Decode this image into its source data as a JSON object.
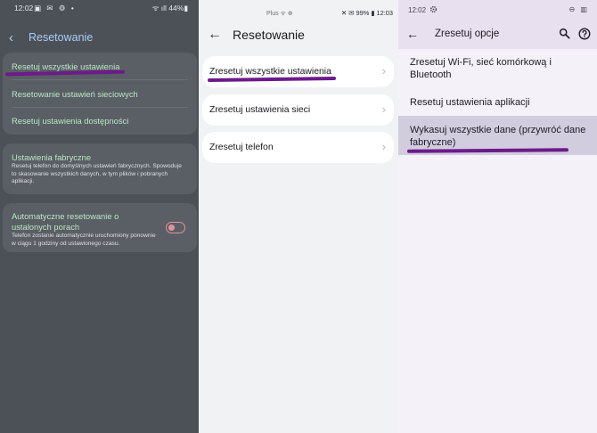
{
  "colors": {
    "samsung_bg": "#4c5057",
    "samsung_card": "#5a5e65",
    "samsung_title": "#a9cdf3",
    "samsung_item": "#b9e7c3",
    "vivo_bg": "#f1f2f4",
    "pixel_bg": "#f5f1f9",
    "pixel_header": "#e8e0ee",
    "pixel_highlight": "#d1ccde",
    "underline": "#6d1a8a"
  },
  "samsung": {
    "status": {
      "time": "12:02",
      "icons": "▣ ✉ ⚙ •",
      "right": "ᯤ ıll 44%▮"
    },
    "header": {
      "title": "Resetowanie"
    },
    "items": [
      {
        "label": "Resetuj wszystkie ustawienia"
      },
      {
        "label": "Resetowanie ustawień sieciowych"
      },
      {
        "label": "Resetuj ustawienia dostępności"
      }
    ],
    "factory": {
      "title": "Ustawienia fabryczne",
      "description": "Resetuj telefon do domyślnych ustawień fabrycznych. Spowoduje to skasowanie wszystkich danych, w tym plików i pobranych aplikacji."
    },
    "auto_reset": {
      "title": "Automatyczne resetowanie o ustalonych porach",
      "description": "Telefon zostanie automatycznie uruchomiony ponownie w ciągu 1 godziny od ustawionego czasu.",
      "enabled": false
    }
  },
  "vivo": {
    "status": {
      "center": "Plus  ᯤ ⊕",
      "right": "✕ ✉ 99% ▮ 12:03"
    },
    "header": {
      "title": "Resetowanie"
    },
    "items": [
      {
        "label": "Zresetuj wszystkie ustawienia"
      },
      {
        "label": "Zresetuj ustawienia sieci"
      },
      {
        "label": "Zresetuj telefon"
      }
    ]
  },
  "pixel": {
    "status": {
      "time": "12:02",
      "right": "⊖ ▥"
    },
    "header": {
      "title": "Zresetuj opcje"
    },
    "items": [
      {
        "label": "Zresetuj Wi-Fi, sieć komórkową i Bluetooth"
      },
      {
        "label": "Resetuj ustawienia aplikacji"
      },
      {
        "label": "Wykasuj wszystkie dane (przywróć dane fabryczne)"
      }
    ]
  }
}
